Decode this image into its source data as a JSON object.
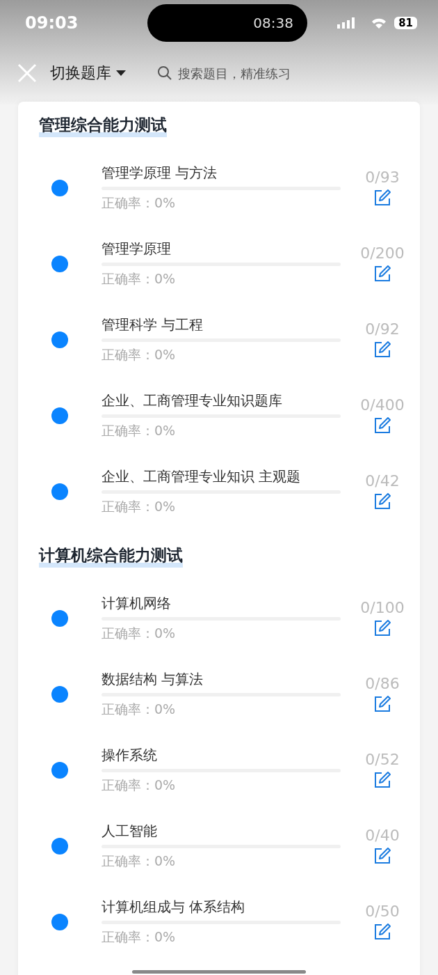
{
  "status_bar": {
    "time": "09:03",
    "time_2": "08:38",
    "battery": "81"
  },
  "header": {
    "switch_label": "切换题库",
    "search": {
      "placeholder": "搜索题目，精准练习"
    }
  },
  "sections": [
    {
      "title": "管理综合能力测试",
      "items": [
        {
          "name": "管理学原理 与方法",
          "accuracy": "正确率：0%",
          "count": "0/93"
        },
        {
          "name": "管理学原理",
          "accuracy": "正确率：0%",
          "count": "0/200"
        },
        {
          "name": "管理科学 与工程",
          "accuracy": "正确率：0%",
          "count": "0/92"
        },
        {
          "name": "企业、工商管理专业知识题库",
          "accuracy": "正确率：0%",
          "count": "0/400"
        },
        {
          "name": "企业、工商管理专业知识 主观题",
          "accuracy": "正确率：0%",
          "count": "0/42"
        }
      ]
    },
    {
      "title": "计算机综合能力测试",
      "items": [
        {
          "name": "计算机网络",
          "accuracy": "正确率：0%",
          "count": "0/100"
        },
        {
          "name": "数据结构 与算法",
          "accuracy": "正确率：0%",
          "count": "0/86"
        },
        {
          "name": "操作系统",
          "accuracy": "正确率：0%",
          "count": "0/52"
        },
        {
          "name": "人工智能",
          "accuracy": "正确率：0%",
          "count": "0/40"
        },
        {
          "name": "计算机组成与 体系结构",
          "accuracy": "正确率：0%",
          "count": "0/50"
        }
      ]
    }
  ]
}
